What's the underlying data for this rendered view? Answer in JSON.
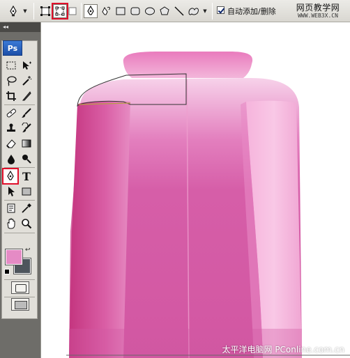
{
  "options_bar": {
    "auto_add_delete_label": "自动添加/删除",
    "auto_add_delete_checked": true
  },
  "watermark_top": {
    "line1": "网页教学网",
    "line2": "WWW.WEB3X.CN"
  },
  "toolbox": {
    "collapse_label": "◂◂",
    "logo_text": "Ps",
    "type_tool_label": "T"
  },
  "colors": {
    "foreground": "#e58bc5",
    "background": "#4e555c",
    "highlight": "#e0102b"
  },
  "icons": [
    "pen-tool-icon",
    "dropdown-arrow-icon",
    "shape-layers-icon",
    "paths-icon",
    "fill-pixels-icon",
    "pen-icon",
    "freeform-pen-icon",
    "rectangle-icon",
    "rounded-rectangle-icon",
    "ellipse-icon",
    "polygon-icon",
    "line-icon",
    "custom-shape-icon"
  ],
  "watermark_bottom": "太平洋电脑网 PConline.com.cn"
}
